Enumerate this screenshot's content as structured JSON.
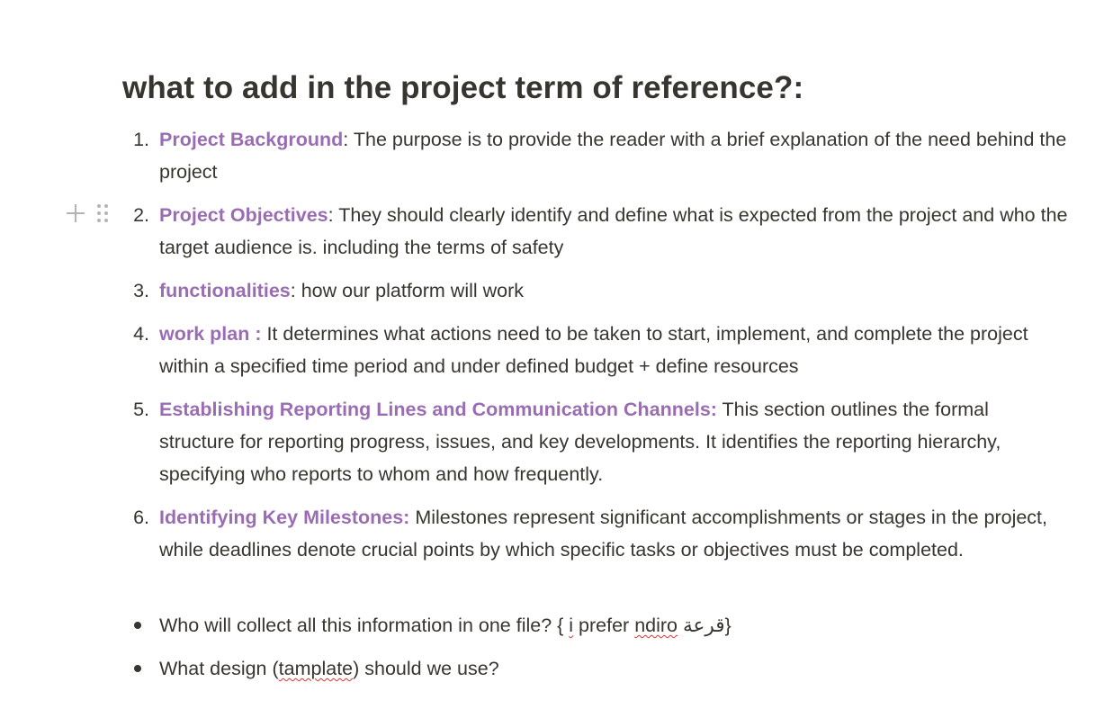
{
  "heading": "what to add in the project term of reference?:",
  "numbered_items": [
    {
      "marker": "1.",
      "title": "Project Background",
      "sep": ":",
      "text": " The purpose is to provide the reader with a brief explanation of the need behind the project"
    },
    {
      "marker": "2.",
      "title": "Project Objectives",
      "sep": ":",
      "text": " They should clearly identify and define what is expected from the project and who the target audience is. including the terms of safety"
    },
    {
      "marker": "3.",
      "title": "functionalities",
      "sep": ":",
      "text": " how our platform will work"
    },
    {
      "marker": "4.",
      "title": "work plan :",
      "sep": "",
      "text": " It determines what actions need to be taken to start, implement, and complete the project within a specified time period and under defined budget + define resources"
    },
    {
      "marker": "5.",
      "title": "Establishing Reporting Lines and Communication Channels:",
      "sep": "",
      "text": " This section outlines the formal structure for reporting progress, issues, and key developments. It identifies the reporting hierarchy, specifying who reports to whom and how frequently."
    },
    {
      "marker": "6.",
      "title": "Identifying Key Milestones:",
      "sep": "",
      "text": " Milestones represent significant accomplishments or stages in the project, while deadlines denote crucial points by which specific tasks or objectives must be completed."
    }
  ],
  "bullets": [
    {
      "pre": "Who will collect all this information in one file? { ",
      "w1": "i",
      "mid": " prefer ",
      "w2": "ndiro",
      "post": " قرعة}"
    },
    {
      "pre": "What design (",
      "w1": "tamplate",
      "post": ") should we use?"
    }
  ],
  "icons": {
    "add_block": "plus-icon",
    "drag_handle": "drag-handle-icon"
  },
  "colors": {
    "text": "#37352f",
    "highlight": "#9a6db3",
    "spellcheck": "#dd3333"
  }
}
